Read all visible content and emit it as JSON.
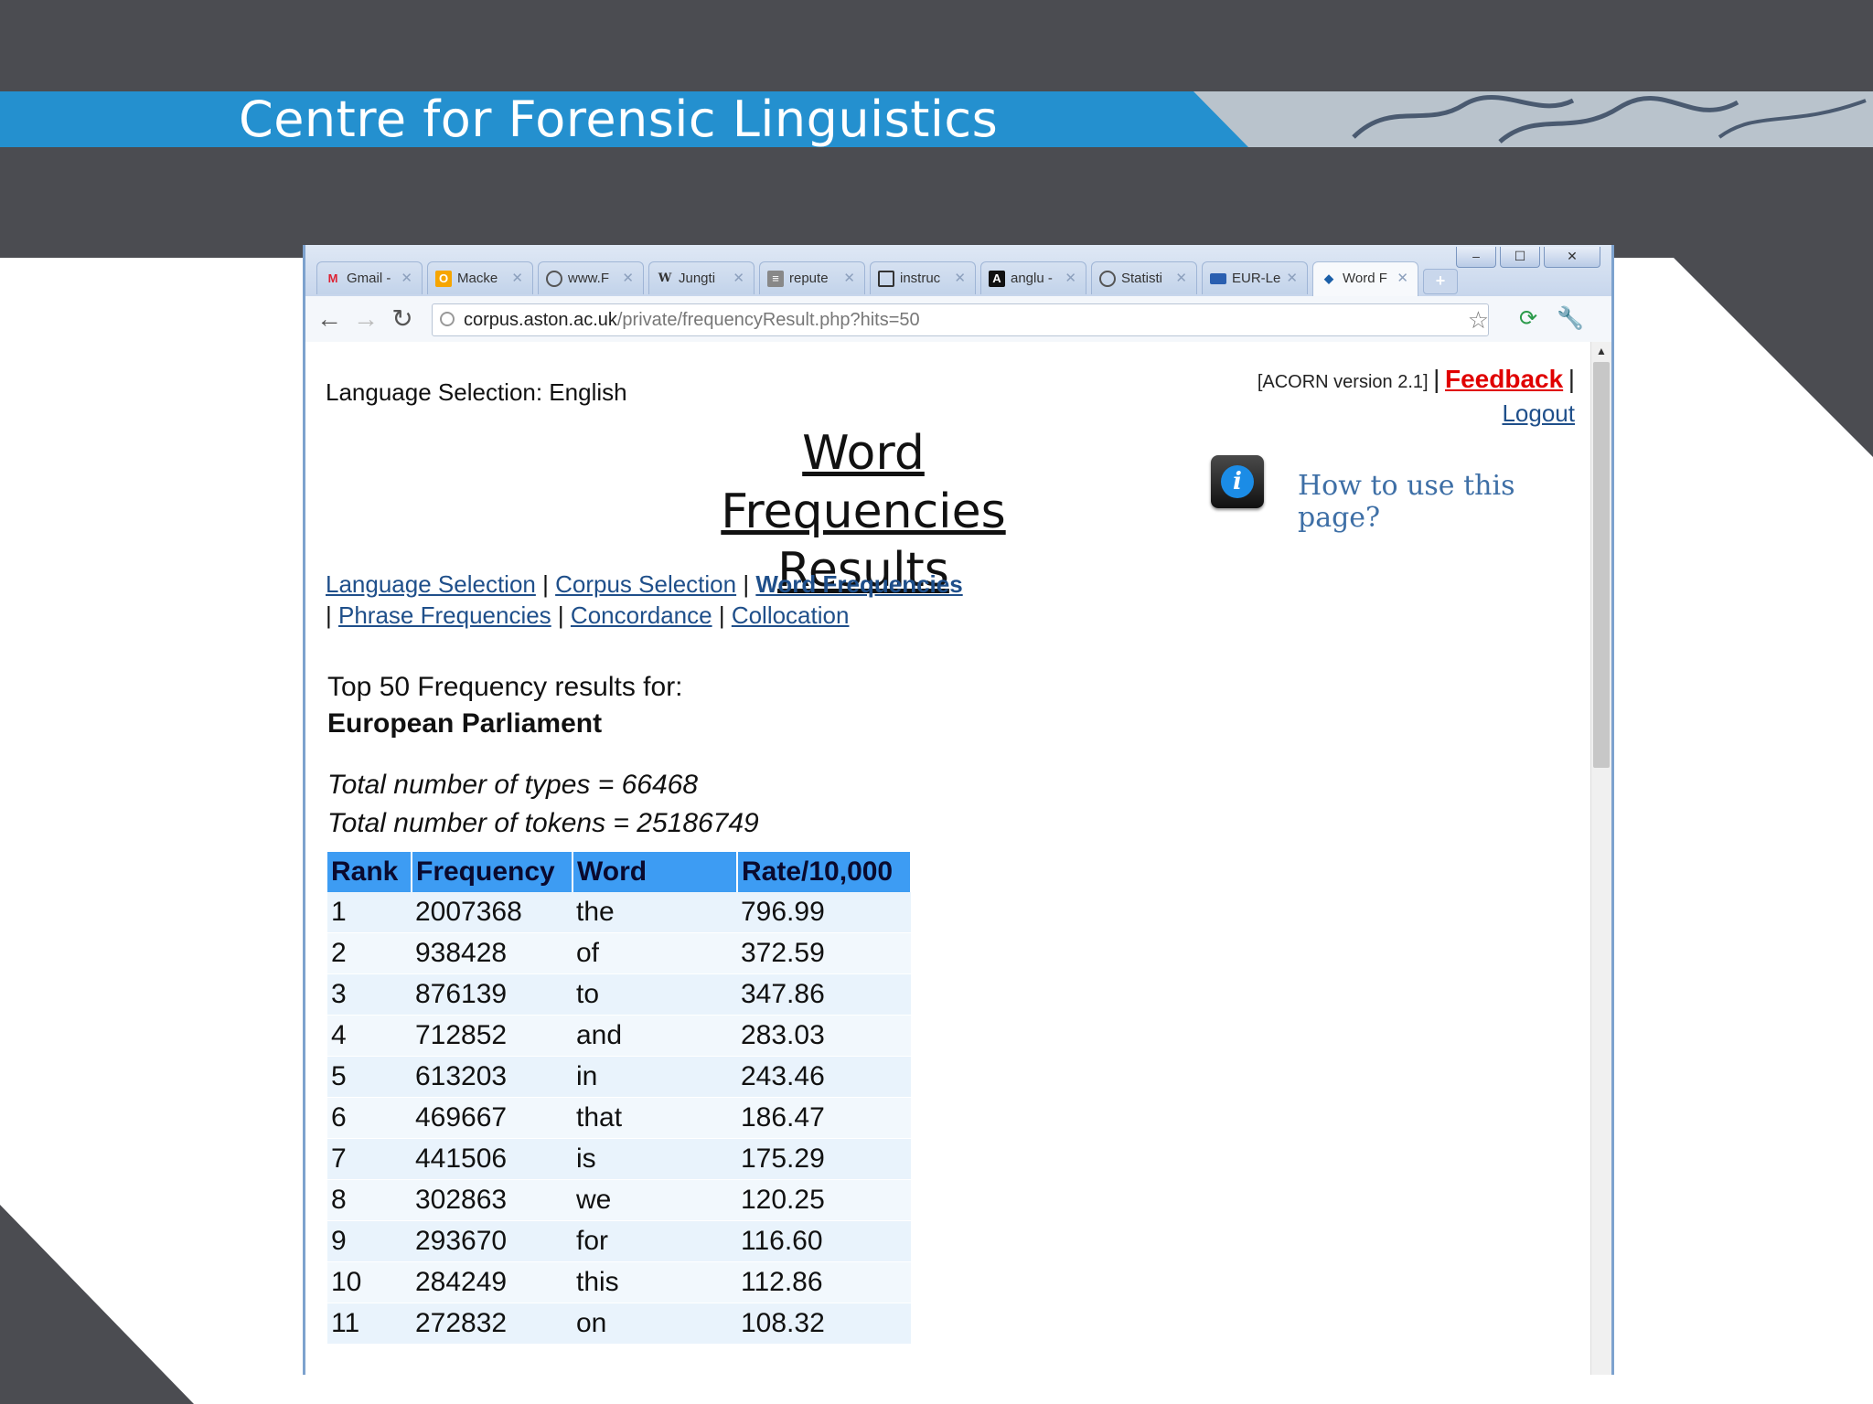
{
  "slide": {
    "banner_title": "Centre for Forensic Linguistics",
    "colors": {
      "dark": "#4b4c51",
      "banner": "#2490cf",
      "white": "#ffffff"
    }
  },
  "browser": {
    "tabs": [
      {
        "label": "Gmail -",
        "icon": "gmail-icon"
      },
      {
        "label": "Macke",
        "icon": "orange-favicon"
      },
      {
        "label": "www.F",
        "icon": "globe-icon"
      },
      {
        "label": "Jungti",
        "icon": "wikipedia-icon"
      },
      {
        "label": "repute",
        "icon": "document-icon"
      },
      {
        "label": "instruc",
        "icon": "book-icon"
      },
      {
        "label": "anglu -",
        "icon": "font-icon"
      },
      {
        "label": "Statisti",
        "icon": "globe-icon"
      },
      {
        "label": "EUR-Le",
        "icon": "monitor-icon"
      },
      {
        "label": "Word F",
        "icon": "bird-icon",
        "active": true
      }
    ],
    "new_tab": "+",
    "url_host": "corpus.aston.ac.uk",
    "url_path": "/private/frequencyResult.php?hits=50"
  },
  "page": {
    "language_selection": "Language Selection: English",
    "version": "[ACORN version 2.1]",
    "feedback": "Feedback",
    "sep": "|",
    "logout": "Logout",
    "title": "Word Frequencies Results",
    "help": "How to use this page?",
    "nav": {
      "language": "Language Selection",
      "corpus": "Corpus Selection",
      "word": "Word Frequencies",
      "phrase": "Phrase Frequencies",
      "concordance": "Concordance",
      "collocation": "Collocation"
    },
    "results_heading": "Top 50 Frequency results for:",
    "corpus_name": "European Parliament",
    "total_types": "Total number of types = 66468",
    "total_tokens": "Total number of tokens = 25186749",
    "table": {
      "headers": [
        "Rank",
        "Frequency",
        "Word",
        "Rate/10,000"
      ],
      "rows": [
        [
          "1",
          "2007368",
          "the",
          "796.99"
        ],
        [
          "2",
          "938428",
          "of",
          "372.59"
        ],
        [
          "3",
          "876139",
          "to",
          "347.86"
        ],
        [
          "4",
          "712852",
          "and",
          "283.03"
        ],
        [
          "5",
          "613203",
          "in",
          "243.46"
        ],
        [
          "6",
          "469667",
          "that",
          "186.47"
        ],
        [
          "7",
          "441506",
          "is",
          "175.29"
        ],
        [
          "8",
          "302863",
          "we",
          "120.25"
        ],
        [
          "9",
          "293670",
          "for",
          "116.60"
        ],
        [
          "10",
          "284249",
          "this",
          "112.86"
        ],
        [
          "11",
          "272832",
          "on",
          "108.32"
        ]
      ]
    }
  }
}
